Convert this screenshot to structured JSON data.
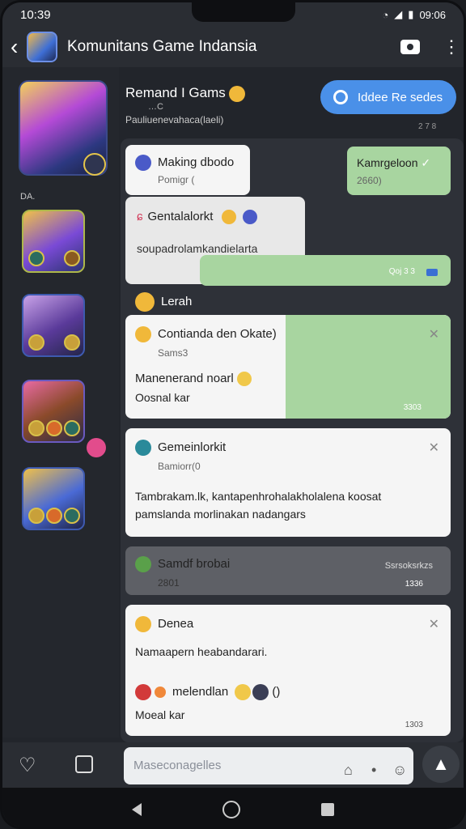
{
  "status_bar": {
    "time": "10:39",
    "right": "09:06"
  },
  "header": {
    "title": "Komunitans Game Indansia"
  },
  "sidebar": {
    "label": "DA."
  },
  "group": {
    "title": "Remand I Gams",
    "sub1": "…C",
    "sub2": "Pauliuenevahaca(laeli)",
    "join_button": "Iddee Re sedes",
    "time": "2 7 8"
  },
  "messages": {
    "m1_title": "Making dbodo",
    "m1_sub": "Pomigr (",
    "m2_text": "Kamrgeloon",
    "m2_time": "2660)",
    "m3_title": "Gentalalorkt",
    "m3_body": "soupadrolamkandielarta",
    "m3_time": "Qoj 3 3",
    "section_label": "Lerah",
    "c1_title": "Contianda den Okate)",
    "c1_sub": "Sams3",
    "c1_body": "Manenerand noarl",
    "c1_foot": "Oosnal kar",
    "c1_time": "3303",
    "c2_title": "Gemeinlorkit",
    "c2_sub": "Bamiorr(0",
    "c2_body1": "Tambrakam.lk, kantapenhrohalakholalena koosat",
    "c2_body2": "pamslanda morlinakan nadangars",
    "c3_title": "Samdf brobai",
    "c3_sub": "2801",
    "c3_right": "Ssrsoksrkzs",
    "c3_time": "1336",
    "c4_title": "Denea",
    "c4_body": "Namaapern heabandarari.",
    "c4_line": "melendlan",
    "c4_foot": "Moeal kar",
    "c4_time": "1303"
  },
  "composer": {
    "placeholder": "Maseconagelles"
  }
}
